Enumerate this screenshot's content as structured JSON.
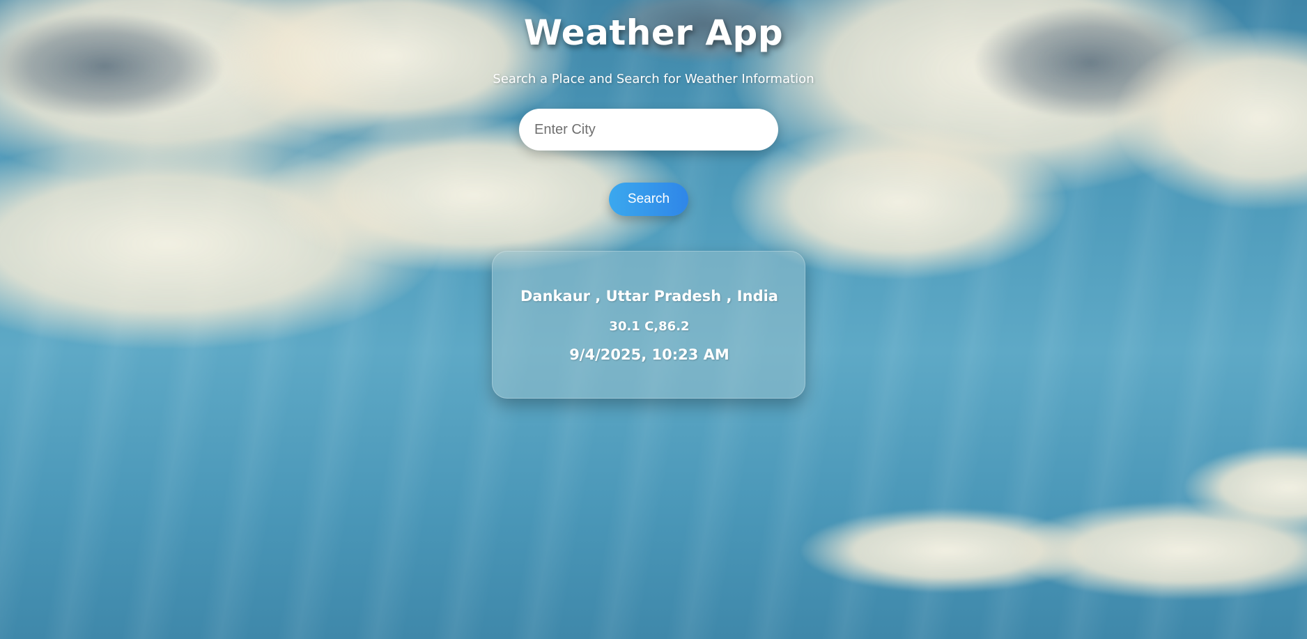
{
  "app": {
    "title": "Weather App",
    "subtitle": "Search a Place and Search for Weather Information"
  },
  "search": {
    "placeholder": "Enter City",
    "value": "",
    "button_label": "Search"
  },
  "result": {
    "location": "Dankaur , Uttar Pradesh , India",
    "temperature": "30.1 C,86.2",
    "datetime": "9/4/2025, 10:23 AM"
  },
  "colors": {
    "button_gradient_start": "#3ba8ee",
    "button_gradient_end": "#2f86e8",
    "sky": "#4e9bbb",
    "text": "#ffffff"
  }
}
